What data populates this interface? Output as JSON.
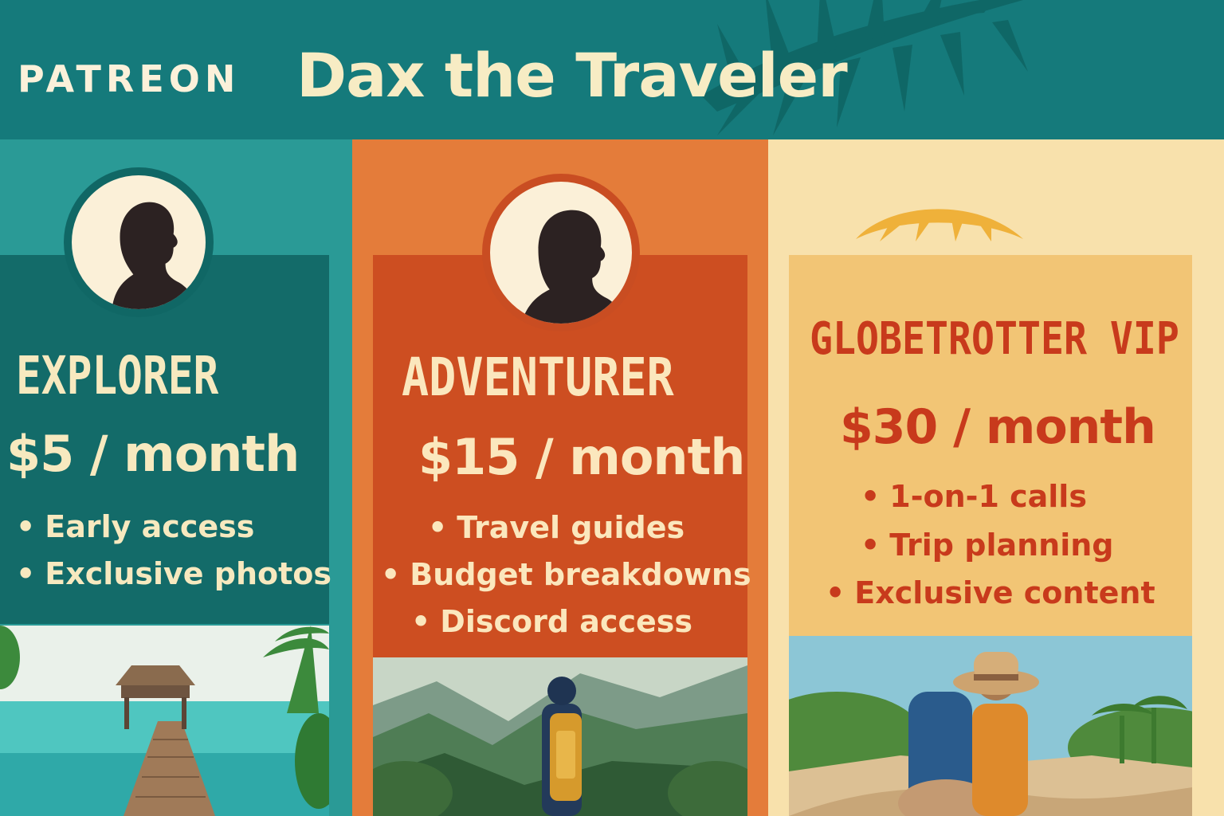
{
  "header": {
    "brand": "PATREON",
    "title": "Dax the Traveler"
  },
  "tiers": [
    {
      "name": "EXPLORER",
      "price": "$5 / month",
      "benefits": [
        "Early access",
        "Exclusive photos"
      ],
      "color": "#136b69",
      "photo_icon": "beach-pier-photo"
    },
    {
      "name": "ADVENTURER",
      "price": "$15 / month",
      "benefits": [
        "Travel guides",
        "Budget breakdowns",
        "Discord access"
      ],
      "color": "#cd4e21",
      "photo_icon": "mountain-hiker-photo"
    },
    {
      "name": "GLOBETROTTER VIP",
      "price": "$30 / month",
      "benefits": [
        "1-on-1 calls",
        "Trip planning",
        "Exclusive content"
      ],
      "color": "#f2c575",
      "photo_icon": "beach-travelers-photo"
    }
  ],
  "colors": {
    "header_bg": "#157a7b",
    "cream": "#fbf0d8",
    "teal": "#2a9a96",
    "orange": "#e47c3a",
    "sand": "#f8e1ac",
    "red_text": "#c83a1c"
  }
}
